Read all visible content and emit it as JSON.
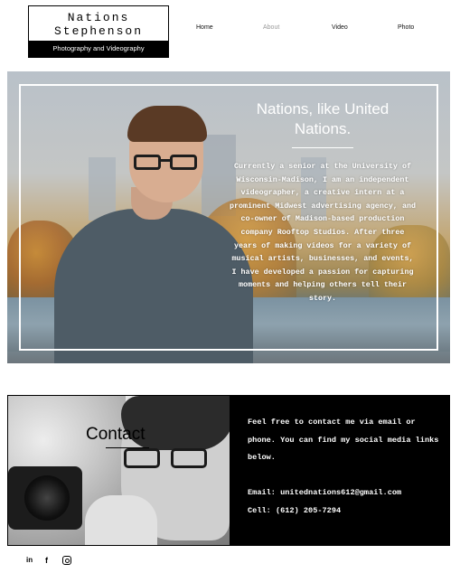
{
  "brand": {
    "name_line1": "Nations",
    "name_line2": "Stephenson",
    "tagline": "Photography and Videography"
  },
  "nav": {
    "items": [
      {
        "label": "Home",
        "active": false
      },
      {
        "label": "About",
        "active": true
      },
      {
        "label": "Video",
        "active": false
      },
      {
        "label": "Photo",
        "active": false
      }
    ]
  },
  "hero": {
    "title_line1": "Nations, like United",
    "title_line2": "Nations.",
    "bio": "Currently a senior at the University of Wisconsin-Madison, I am an independent videographer, a creative intern at a prominent Midwest advertising agency, and co-owner of Madison-based production company Rooftop Studios. After three years of making videos for a variety of musical artists, businesses, and events, I have developed a passion for capturing moments and helping others tell their story."
  },
  "contact": {
    "title": "Contact",
    "intro": "Feel free to contact me via email or phone. You can find my social media links below.",
    "email": "Email: unitednations612@gmail.com",
    "cell": "Cell: (612) 205-7294"
  },
  "social": {
    "linkedin_glyph": "in",
    "facebook_glyph": "f",
    "icons": [
      "linkedin-icon",
      "facebook-icon",
      "instagram-icon"
    ]
  },
  "colors": {
    "accent": "#000000",
    "nav_active": "#9a9a9a",
    "text_on_dark": "#ffffff"
  }
}
